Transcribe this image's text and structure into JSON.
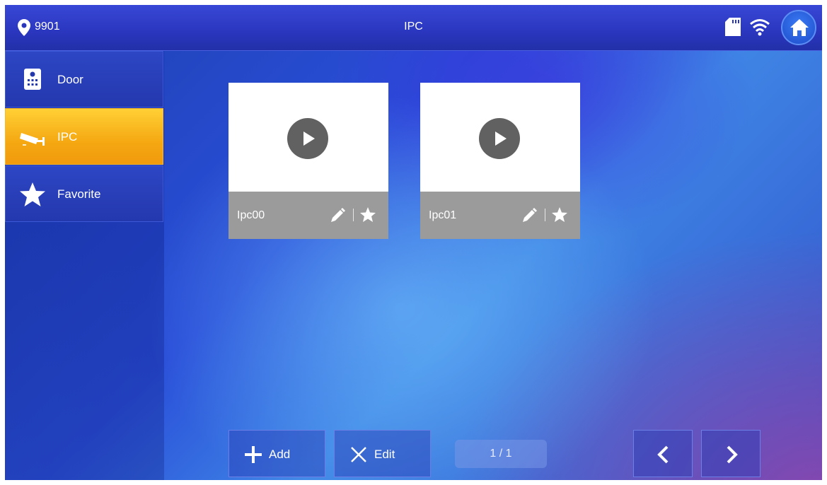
{
  "header": {
    "location": "9901",
    "title": "IPC",
    "icons": [
      "location-pin-icon",
      "sd-card-icon",
      "wifi-icon",
      "home-icon"
    ]
  },
  "sidebar": {
    "items": [
      {
        "label": "Door",
        "icon": "door-intercom-icon",
        "active": false
      },
      {
        "label": "IPC",
        "icon": "security-camera-icon",
        "active": true
      },
      {
        "label": "Favorite",
        "icon": "star-icon",
        "active": false
      }
    ]
  },
  "cameras": [
    {
      "name": "Ipc00",
      "icons": [
        "play-icon",
        "edit-icon",
        "favorite-star-icon"
      ]
    },
    {
      "name": "Ipc01",
      "icons": [
        "play-icon",
        "edit-icon",
        "favorite-star-icon"
      ]
    }
  ],
  "toolbar": {
    "add_label": "Add",
    "edit_label": "Edit",
    "page_indicator": "1 / 1"
  },
  "colors": {
    "active_tab": "#f5a812",
    "card_footer": "#9b9b9b",
    "play_button": "#616161"
  }
}
